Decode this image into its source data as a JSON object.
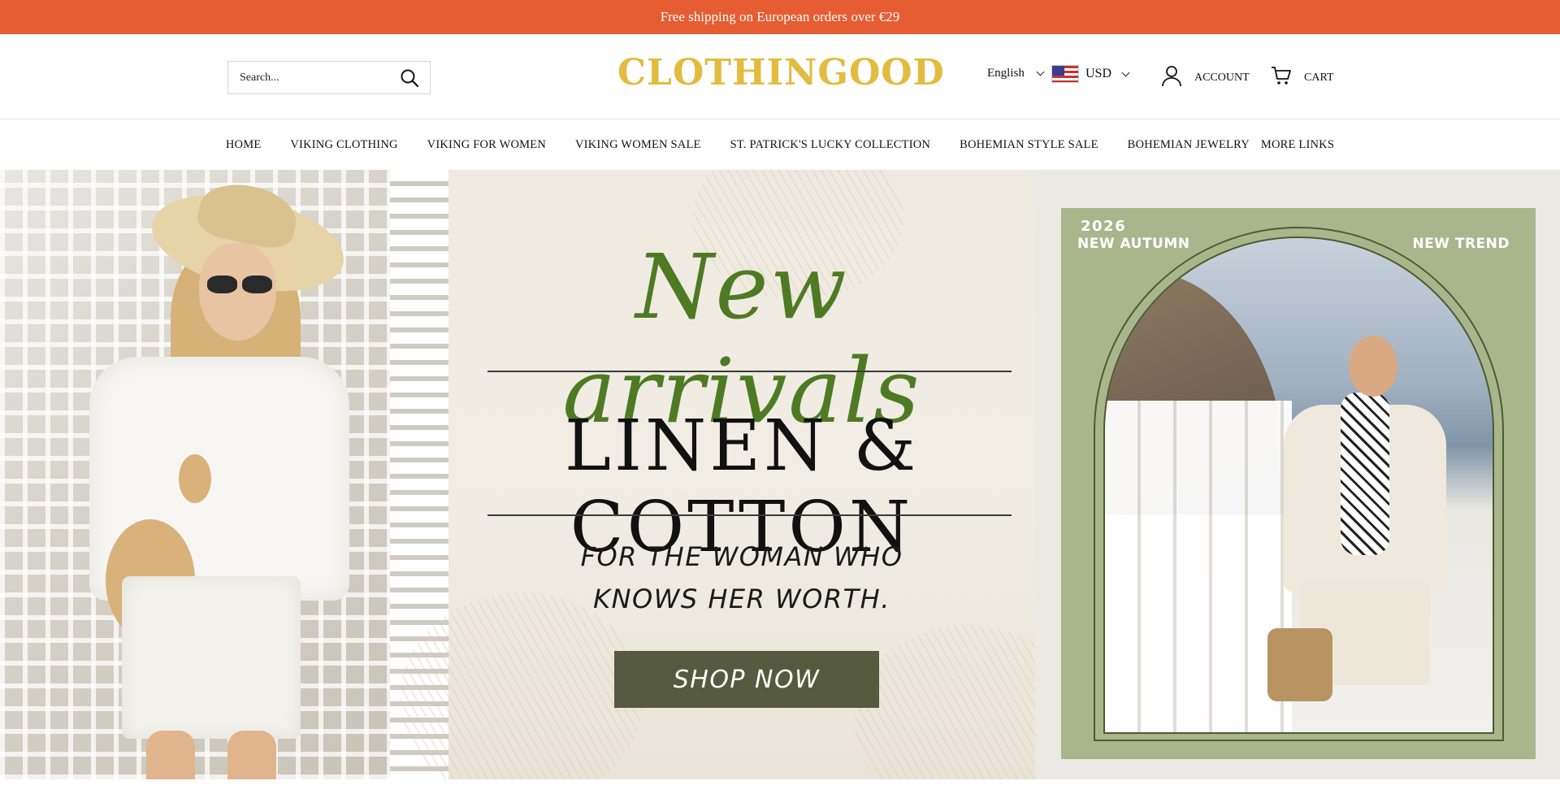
{
  "announcement": {
    "text": "Free shipping on European orders over €29"
  },
  "header": {
    "search": {
      "placeholder": "Search..."
    },
    "logo": "CLOTHINGOOD",
    "language": "English",
    "currency": "USD",
    "account_label": "ACCOUNT",
    "cart_label": "CART",
    "icons": {
      "search": "search-icon",
      "flag": "us-flag-icon",
      "account": "user-icon",
      "cart": "cart-icon"
    }
  },
  "nav": {
    "items": [
      "HOME",
      "VIKING CLOTHING",
      "VIKING FOR WOMEN",
      "VIKING WOMEN SALE",
      "ST. PATRICK'S LUCKY COLLECTION",
      "BOHEMIAN STYLE SALE",
      "BOHEMIAN JEWELRY",
      "MORE LINKS"
    ]
  },
  "hero": {
    "script_title": "New arrivals",
    "headline": "LINEN & COTTON",
    "tagline_line1": "FOR THE WOMAN WHO",
    "tagline_line2": "KNOWS HER WORTH.",
    "cta": "SHOP NOW",
    "card": {
      "year": "2026",
      "left_label": "NEW AUTUMN",
      "right_label": "NEW TREND"
    }
  },
  "colors": {
    "announcement_bg": "#e65c33",
    "logo": "#e3bb3f",
    "script": "#4f7a24",
    "cta_bg": "#565a3e",
    "card_bg": "#a9b68c"
  }
}
